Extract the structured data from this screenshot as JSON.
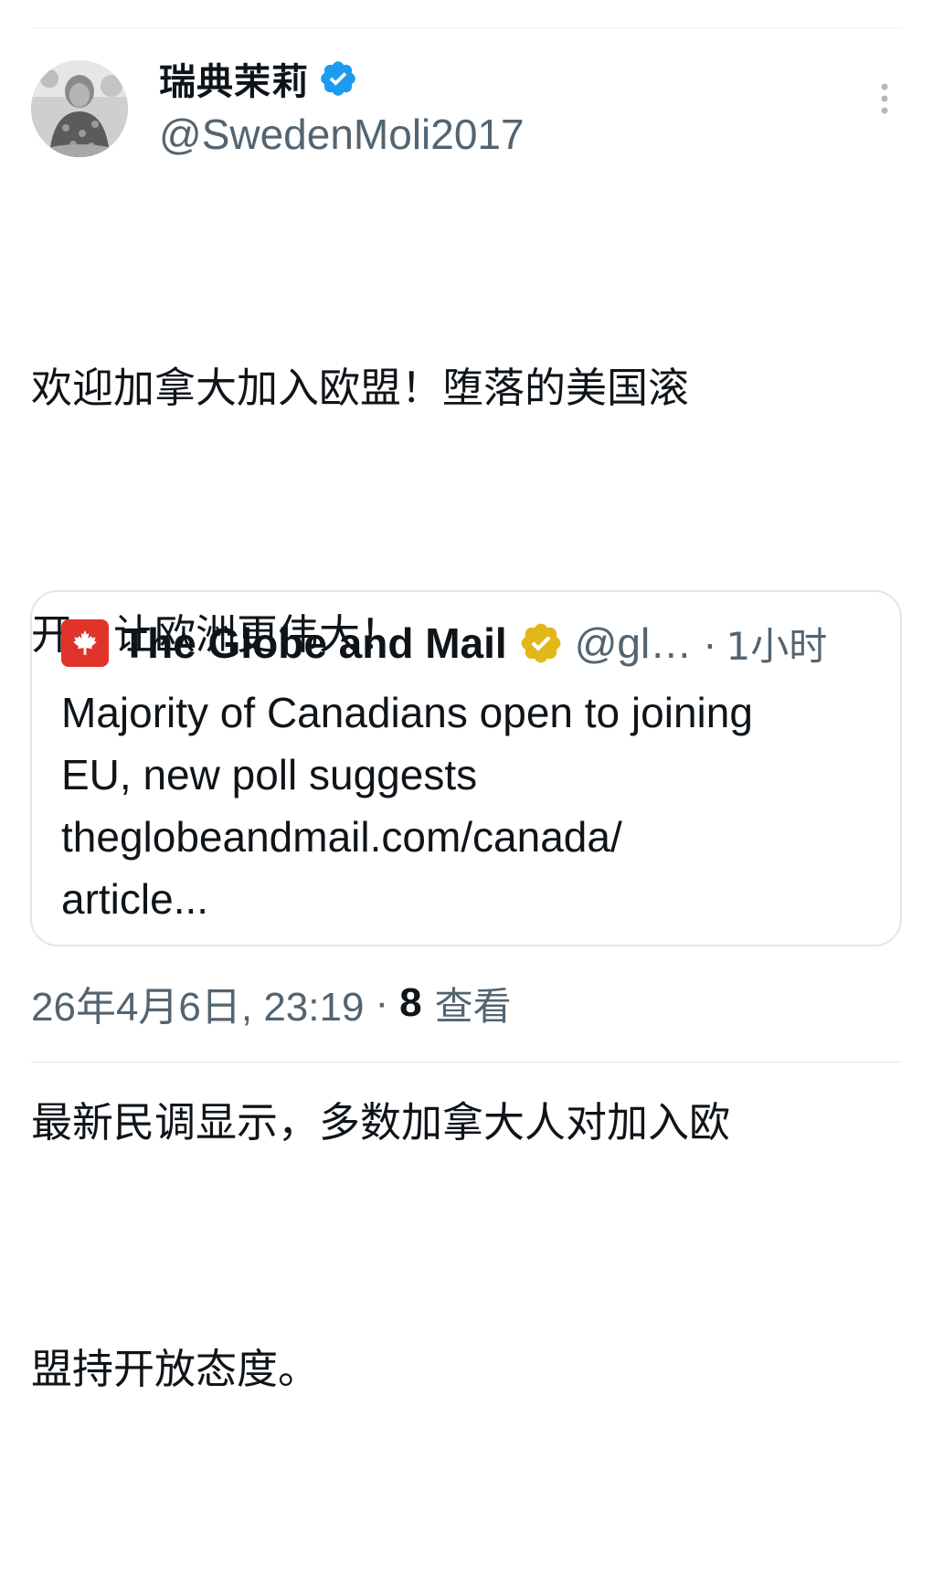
{
  "tweet": {
    "author": {
      "display_name": "瑞典茉莉",
      "handle": "@SwedenMoli2017",
      "verified": true,
      "avatar_icon": "person-photo-avatar"
    },
    "more_icon": "more-vertical-icon",
    "text_paragraphs": [
      [
        "欢迎加拿大加入欧盟！堕落的美国滚",
        "开，让欧洲更伟大！"
      ],
      [
        "最新民调显示，多数加拿大人对加入欧",
        "盟持开放态度。"
      ]
    ],
    "quoted": {
      "logo_icon": "maple-leaf-icon",
      "name": "The Globe and Mail",
      "verified_gold": true,
      "handle": "@gl…",
      "dot": "·",
      "time": "1小时",
      "text_lines": [
        "Majority of Canadians open to joining",
        "EU, new poll suggests",
        "theglobeandmail.com/canada/",
        "article..."
      ]
    },
    "timestamp": "26年4月6日, 23:19",
    "separator": "·",
    "views_count": "8",
    "views_label": "查看"
  },
  "colors": {
    "text_primary": "#0f1419",
    "text_secondary": "#536471",
    "verified_blue": "#1d9bf0",
    "verified_gold": "#e2b719",
    "globe_red": "#e0342a",
    "border": "#e1e6e9"
  }
}
